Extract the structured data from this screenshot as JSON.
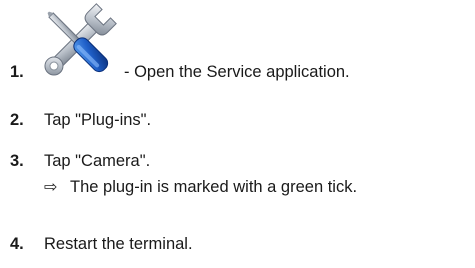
{
  "icons": {
    "service_app_icon": "wrench-screwdriver-icon"
  },
  "steps": [
    {
      "number": "1.",
      "text": "- Open the Service application."
    },
    {
      "number": "2.",
      "text": "Tap \"Plug-ins\"."
    },
    {
      "number": "3.",
      "text": "Tap \"Camera\"."
    },
    {
      "number": "4.",
      "text": "Restart the terminal."
    }
  ],
  "result": {
    "arrow": "⇨",
    "text": "The plug-in is marked with a green tick."
  }
}
